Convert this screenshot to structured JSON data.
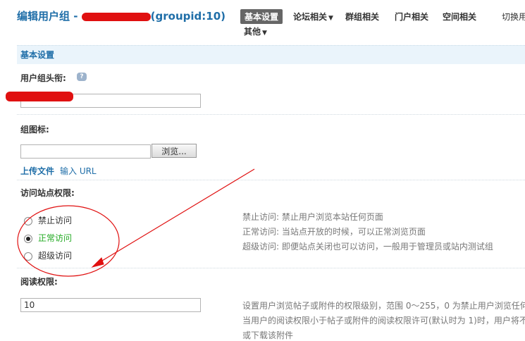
{
  "header": {
    "title_prefix": "编辑用户组 - ",
    "group_id": "(groupid:10)",
    "tabs": [
      {
        "label": "基本设置",
        "active": true
      },
      {
        "label": "论坛相关",
        "has_menu": true
      },
      {
        "label": "群组相关"
      },
      {
        "label": "门户相关"
      },
      {
        "label": "空间相关"
      },
      {
        "label": "切换用"
      },
      {
        "label": "其他",
        "has_menu": true
      }
    ],
    "caret": "▼"
  },
  "section": {
    "title": "基本设置"
  },
  "form": {
    "group_title_label": "用户组头衔:",
    "help_icon_glyph": "?",
    "group_icon_label": "组图标:",
    "browse_button": "浏览...",
    "upload_file_link": "上传文件",
    "input_link": "输入 URL",
    "access_label": "访问站点权限:",
    "access_options": [
      {
        "label": "禁止访问",
        "checked": false
      },
      {
        "label": "正常访问",
        "checked": true
      },
      {
        "label": "超级访问",
        "checked": false
      }
    ],
    "access_hints": [
      "禁止访问: 禁止用户浏览本站任何页面",
      "正常访问: 当站点开放的时候，可以正常浏览页面",
      "超级访问: 即便站点关闭也可以访问，一般用于管理员或站内测试组"
    ],
    "read_perm_label": "阅读权限:",
    "read_perm_value": "10",
    "read_perm_hints": [
      "设置用户浏览帖子或附件的权限级别，范围 0～255，0 为禁止用户浏览任何",
      "当用户的阅读权限小于帖子或附件的阅读权限许可(默认时为 1)时，用户将不",
      "或下载该附件"
    ]
  },
  "colors": {
    "accent": "#1f6ea8",
    "annotation": "#e01010",
    "selected_option": "#22aa22"
  }
}
